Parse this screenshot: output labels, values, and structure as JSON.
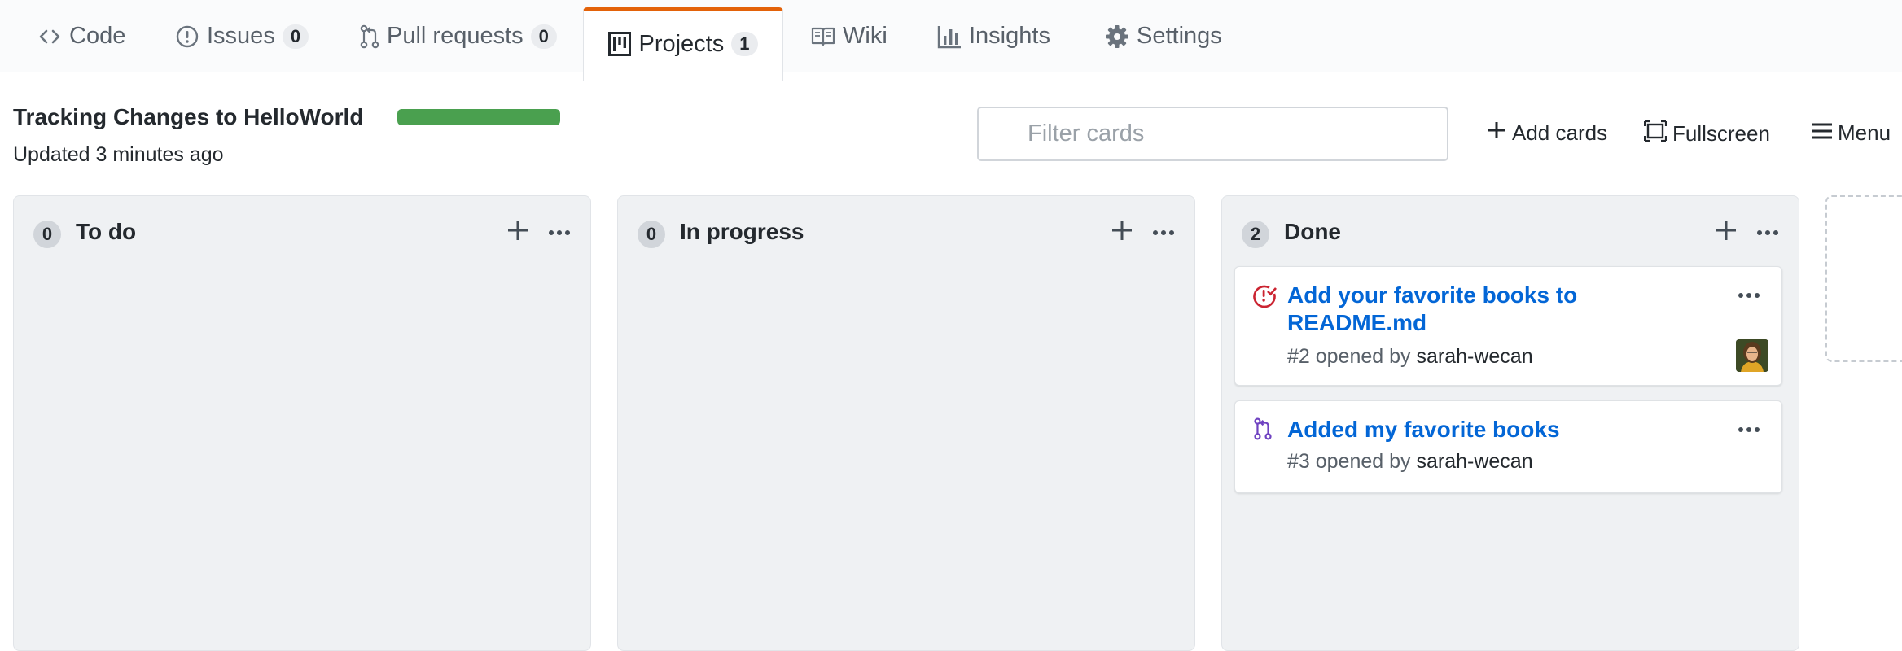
{
  "tabs": [
    {
      "label": "Code",
      "icon": "code-icon"
    },
    {
      "label": "Issues",
      "count": "0",
      "icon": "issue-icon"
    },
    {
      "label": "Pull requests",
      "count": "0",
      "icon": "git-pull-request-icon"
    },
    {
      "label": "Projects",
      "count": "1",
      "icon": "project-icon",
      "selected": true
    },
    {
      "label": "Wiki",
      "icon": "book-icon"
    },
    {
      "label": "Insights",
      "icon": "graph-icon"
    },
    {
      "label": "Settings",
      "icon": "gear-icon"
    }
  ],
  "project": {
    "title": "Tracking Changes to HelloWorld",
    "updated": "Updated 3 minutes ago",
    "progress_fraction": 1.0
  },
  "toolbar": {
    "filter_placeholder": "Filter cards",
    "add_cards": "Add cards",
    "fullscreen": "Fullscreen",
    "menu": "Menu"
  },
  "columns": [
    {
      "count": "0",
      "name": "To do",
      "cards": []
    },
    {
      "count": "0",
      "name": "In progress",
      "cards": []
    },
    {
      "count": "2",
      "name": "Done",
      "cards": [
        {
          "icon": "issue-closed-icon",
          "title": "Add your favorite books to README.md",
          "meta_prefix": "#2 opened by ",
          "author": "sarah-wecan",
          "has_avatar": true
        },
        {
          "icon": "git-pull-request-icon",
          "title": "Added my favorite books",
          "meta_prefix": "#3 opened by ",
          "author": "sarah-wecan",
          "has_avatar": false
        }
      ]
    }
  ],
  "colors": {
    "accent_tab": "#e36209",
    "link": "#0366d6",
    "progress": "#4aa04f",
    "issue_closed": "#cb2431",
    "pull_request": "#6f42c1"
  }
}
